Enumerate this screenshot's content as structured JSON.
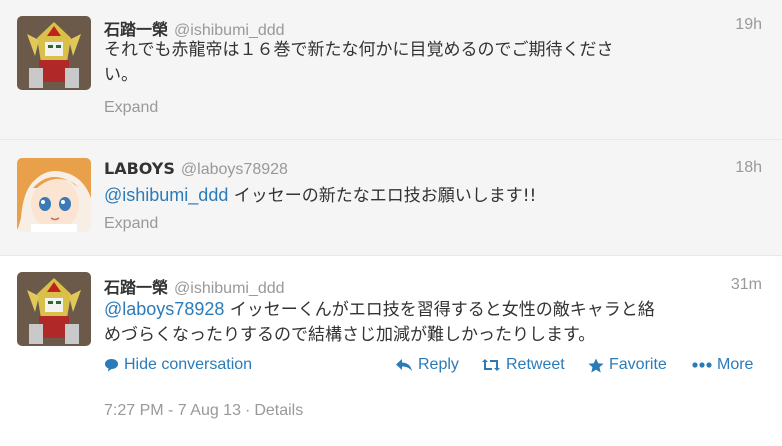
{
  "tweets": [
    {
      "name": "石踏一榮",
      "handle": "@ishibumi_ddd",
      "time": "19h",
      "text_line1": "それでも赤龍帝は１６巻で新たな何かに目覚めるのでご期待くださ",
      "text_line2": "い。",
      "expand": "Expand"
    },
    {
      "name": "LABOYS",
      "handle": "@laboys78928",
      "time": "18h",
      "mention": "@ishibumi_ddd",
      "text": " イッセーの新たなエロ技お願いします!!",
      "expand": "Expand"
    },
    {
      "name": "石踏一榮",
      "handle": "@ishibumi_ddd",
      "time": "31m",
      "mention": "@laboys78928",
      "text_line1": " イッセーくんがエロ技を習得すると女性の敵キャラと絡",
      "text_line2": "めづらくなったりするので結構さじ加減が難しかったりします。",
      "actions": {
        "hide": "Hide conversation",
        "reply": "Reply",
        "retweet": "Retweet",
        "favorite": "Favorite",
        "more": "More"
      },
      "timestamp": "7:27 PM - 7 Aug 13",
      "details": "Details",
      "separator": "·"
    }
  ],
  "colors": {
    "link": "#2b7bb9",
    "muted": "#999999",
    "context_bg": "#f5f5f5"
  }
}
